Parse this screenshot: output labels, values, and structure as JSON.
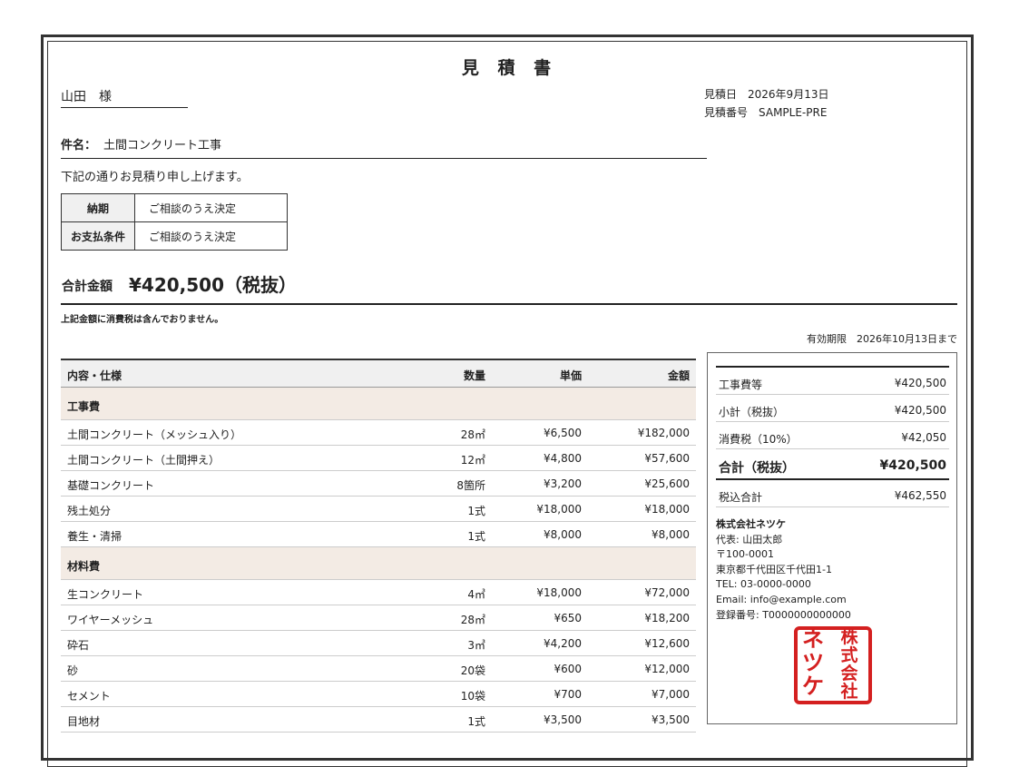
{
  "document": {
    "title": "見 積 書",
    "recipient": "山田　様",
    "date_label": "見積日",
    "date": "2026年9月13日",
    "number_label": "見積番号",
    "number": "SAMPLE-PRE",
    "subject_label": "件名：",
    "subject": "土間コンクリート工事",
    "greeting": "下記の通りお見積り申し上げます。",
    "terms": [
      {
        "label": "納期",
        "value": "ご相談のうえ決定"
      },
      {
        "label": "お支払条件",
        "value": "ご相談のうえ決定"
      }
    ],
    "total_label": "合計金額",
    "total_value": "¥420,500（税抜）",
    "tax_note": "上記金額に消費税は含んでおりません。",
    "validity": "有効期限　2026年10月13日まで"
  },
  "items_table": {
    "headers": [
      "内容・仕様",
      "数量",
      "単価",
      "金額"
    ],
    "sections": [
      {
        "name": "工事費",
        "rows": [
          [
            "土間コンクリート（メッシュ入り）",
            "28㎡",
            "¥6,500",
            "¥182,000"
          ],
          [
            "土間コンクリート（土間押え）",
            "12㎡",
            "¥4,800",
            "¥57,600"
          ],
          [
            "基礎コンクリート",
            "8箇所",
            "¥3,200",
            "¥25,600"
          ],
          [
            "残土処分",
            "1式",
            "¥18,000",
            "¥18,000"
          ],
          [
            "養生・清掃",
            "1式",
            "¥8,000",
            "¥8,000"
          ]
        ]
      },
      {
        "name": "材料費",
        "rows": [
          [
            "生コンクリート",
            "4㎥",
            "¥18,000",
            "¥72,000"
          ],
          [
            "ワイヤーメッシュ",
            "28㎡",
            "¥650",
            "¥18,200"
          ],
          [
            "砕石",
            "3㎥",
            "¥4,200",
            "¥12,600"
          ],
          [
            "砂",
            "20袋",
            "¥600",
            "¥12,000"
          ],
          [
            "セメント",
            "10袋",
            "¥700",
            "¥7,000"
          ],
          [
            "目地材",
            "1式",
            "¥3,500",
            "¥3,500"
          ]
        ]
      }
    ]
  },
  "summary": {
    "rows": [
      {
        "label": "工事費等",
        "value": "¥420,500"
      },
      {
        "label": "小計（税抜）",
        "value": "¥420,500"
      },
      {
        "label": "消費税（10%）",
        "value": "¥42,050"
      },
      {
        "label": "合計（税抜）",
        "value": "¥420,500",
        "grand": true
      },
      {
        "label": "税込合計",
        "value": "¥462,550"
      }
    ]
  },
  "company": {
    "name": "株式会社ネツケ",
    "rep": "代表: 山田太郎",
    "zip": "〒100-0001",
    "address": "東京都千代田区千代田1-1",
    "tel": "TEL: 03-0000-0000",
    "email": "Email: info@example.com",
    "reg": "登録番号: T0000000000000"
  },
  "seal": {
    "text": "株式会社ネツケ",
    "color": "#d42020"
  }
}
